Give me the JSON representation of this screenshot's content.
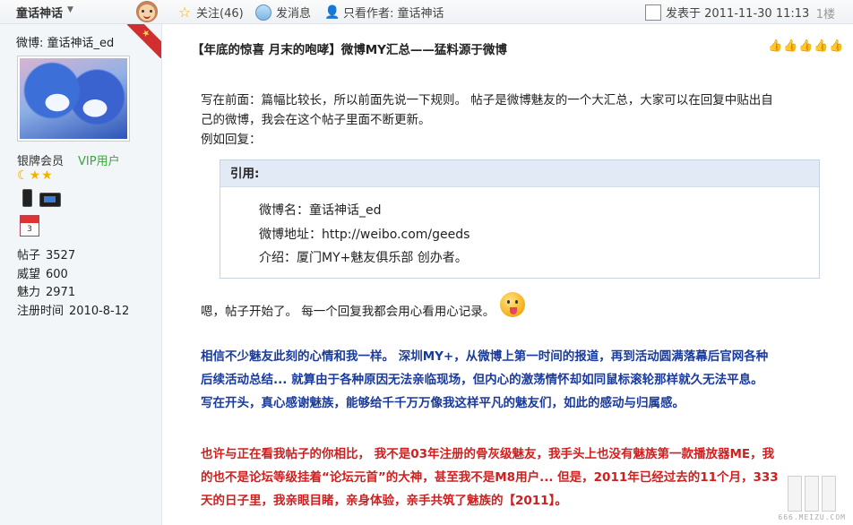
{
  "topbar": {
    "username": "童话神话",
    "follow_label": "关注(46)",
    "message_label": "发消息",
    "only_author_label": "只看作者: 童话神话",
    "posted_label": "发表于 2011-11-30 11:13",
    "floor_label": "1楼"
  },
  "sidebar": {
    "weibo_name": "微博: 童话神话_ed",
    "rank": "银牌会员",
    "vip": "VIP用户",
    "calendar_day": "3",
    "stats": [
      {
        "label": "帖子",
        "value": "3527"
      },
      {
        "label": "威望",
        "value": "600"
      },
      {
        "label": "魅力",
        "value": "2971"
      },
      {
        "label": "注册时间",
        "value": "2010-8-12"
      }
    ]
  },
  "post": {
    "title": "【年底的惊喜 月末的咆哮】微博MY汇总——猛料源于微博",
    "intro_line1": "写在前面：篇幅比较长，所以前面先说一下规则。 帖子是微博魅友的一个大汇总，大家可以在回复中贴出自",
    "intro_line2": "己的微博，我会在这个帖子里面不断更新。",
    "intro_line3": "例如回复：",
    "quote_header": "引用:",
    "quote_line1": "微博名：童话神话_ed",
    "quote_line2": "微博地址：http://weibo.com/geeds",
    "quote_line3": "介绍：厦门MY+魅友俱乐部 创办者。",
    "after_quote": "嗯，帖子开始了。 每一个回复我都会用心看用心记录。",
    "blue_lines": [
      "相信不少魅友此刻的心情和我一样。 深圳MY+，从微博上第一时间的报道，再到活动圆满落幕后官网各种",
      "后续活动总结... 就算由于各种原因无法亲临现场，但内心的激荡情怀却如同鼠标滚轮那样就久无法平息。",
      "写在开头，真心感谢魅族，能够给千千万万像我这样平凡的魅友们，如此的感动与归属感。"
    ],
    "red_lines": [
      "也许与正在看我帖子的你相比， 我不是03年注册的骨灰级魅友，我手头上也没有魅族第一款播放器ME，我",
      "的也不是论坛等级挂着“论坛元首”的大神，甚至我不是M8用户... 但是，2011年已经过去的11个月，333",
      "天的日子里，我亲眼目睹，亲身体验，亲手共筑了魅族的【2011】。"
    ]
  },
  "watermark_text": "666.MEIZU.COM",
  "colors": {
    "blue_text": "#1a3b9e",
    "red_text": "#d01f1f",
    "vip_green": "#3aa53a",
    "quote_header_bg": "#e2ebf5"
  }
}
